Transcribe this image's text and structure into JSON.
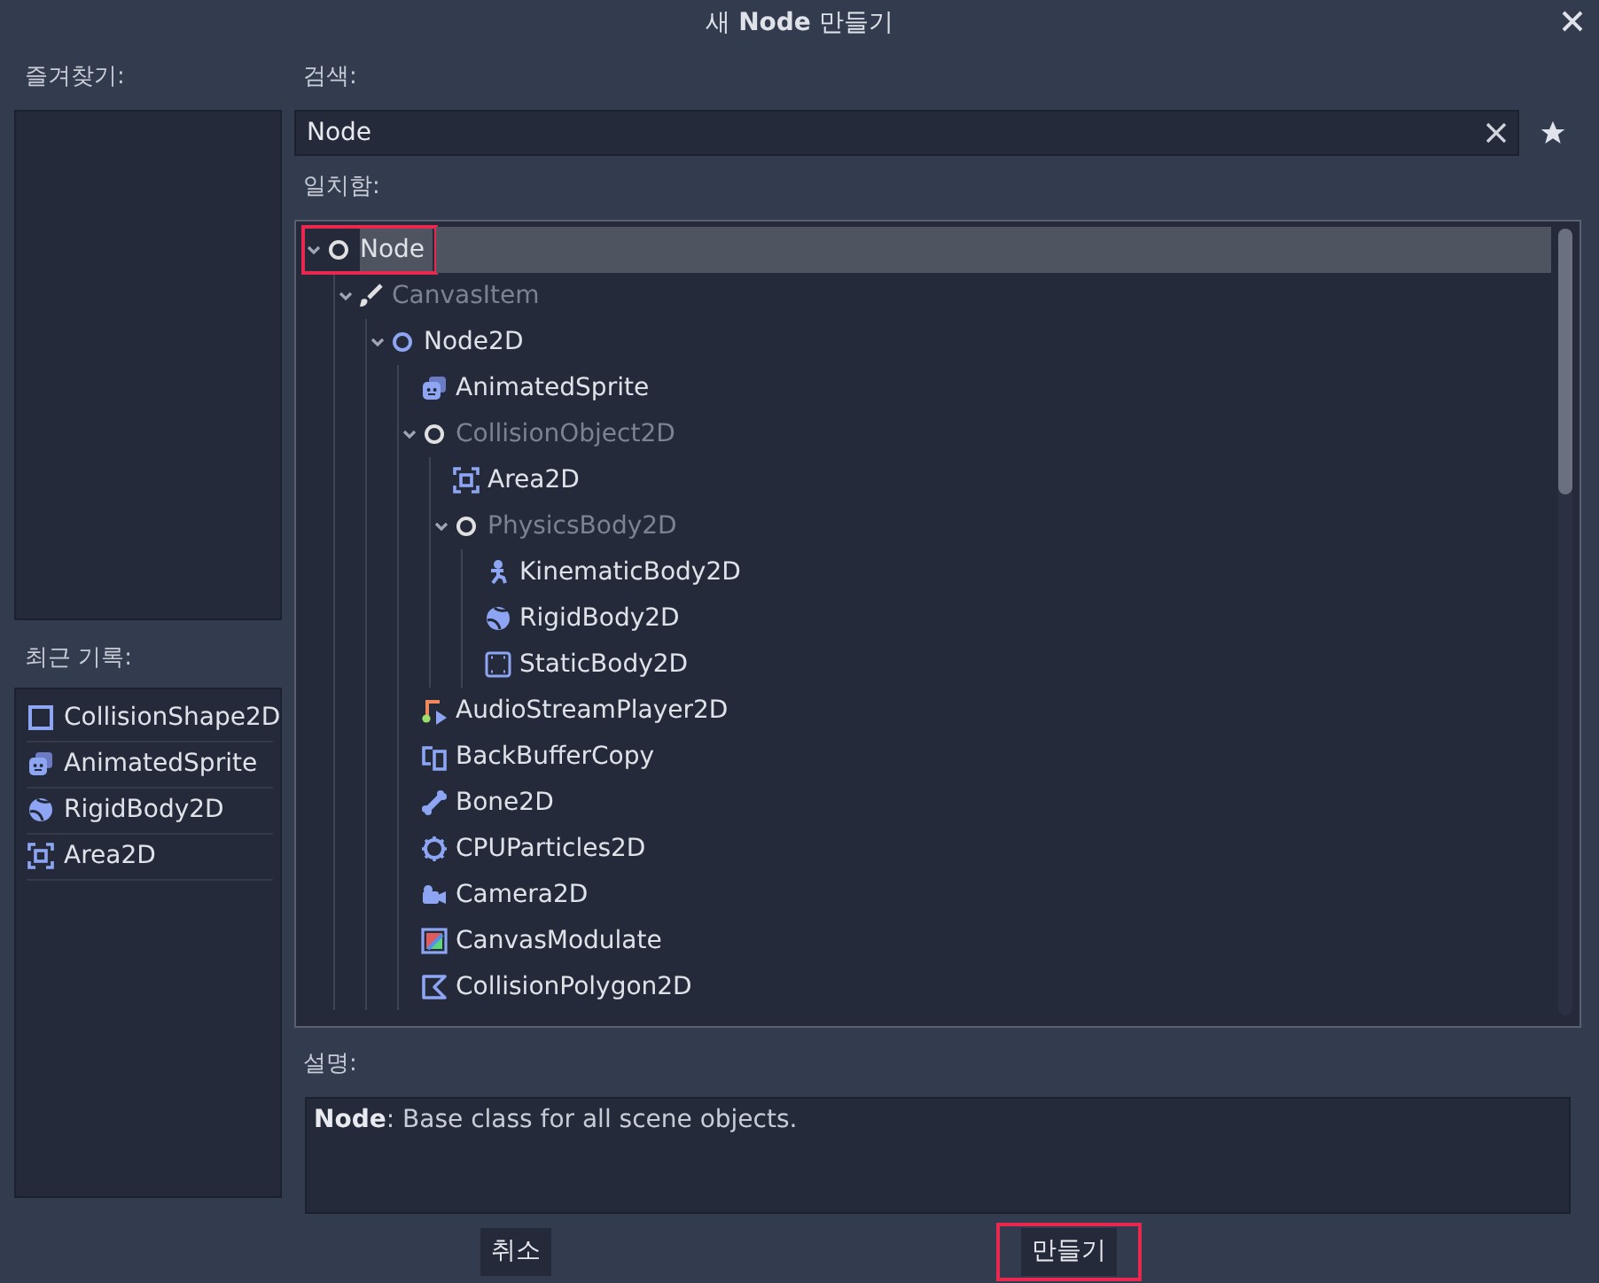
{
  "window": {
    "title": "새 **Node** 만들기"
  },
  "favorites": {
    "label": "즐겨찾기:"
  },
  "recent": {
    "label": "최근 기록:",
    "items": [
      {
        "label": "CollisionShape2D",
        "kind": "shape"
      },
      {
        "label": "AnimatedSprite",
        "kind": "sprite"
      },
      {
        "label": "RigidBody2D",
        "kind": "rigid"
      },
      {
        "label": "Area2D",
        "kind": "area"
      }
    ]
  },
  "search": {
    "label": "검색:",
    "value": "Node"
  },
  "matches": {
    "label": "일치함:",
    "tree": [
      {
        "label": "Node",
        "kind": "node",
        "expanded": true,
        "selected": true,
        "disabled": false,
        "highlighted": true,
        "children": [
          {
            "label": "CanvasItem",
            "kind": "brush",
            "expanded": true,
            "selected": false,
            "disabled": true,
            "highlighted": false,
            "children": [
              {
                "label": "Node2D",
                "kind": "node2d",
                "expanded": true,
                "selected": false,
                "disabled": false,
                "highlighted": false,
                "children": [
                  {
                    "label": "AnimatedSprite",
                    "kind": "sprite",
                    "selected": false,
                    "disabled": false,
                    "highlighted": false
                  },
                  {
                    "label": "CollisionObject2D",
                    "kind": "node",
                    "expanded": true,
                    "selected": false,
                    "disabled": true,
                    "highlighted": false,
                    "children": [
                      {
                        "label": "Area2D",
                        "kind": "area",
                        "selected": false,
                        "disabled": false,
                        "highlighted": false
                      },
                      {
                        "label": "PhysicsBody2D",
                        "kind": "node",
                        "expanded": true,
                        "selected": false,
                        "disabled": true,
                        "highlighted": false,
                        "children": [
                          {
                            "label": "KinematicBody2D",
                            "kind": "kinematic",
                            "selected": false,
                            "disabled": false,
                            "highlighted": false
                          },
                          {
                            "label": "RigidBody2D",
                            "kind": "rigid",
                            "selected": false,
                            "disabled": false,
                            "highlighted": false
                          },
                          {
                            "label": "StaticBody2D",
                            "kind": "static",
                            "selected": false,
                            "disabled": false,
                            "highlighted": false
                          }
                        ]
                      }
                    ]
                  },
                  {
                    "label": "AudioStreamPlayer2D",
                    "kind": "audio",
                    "selected": false,
                    "disabled": false,
                    "highlighted": false
                  },
                  {
                    "label": "BackBufferCopy",
                    "kind": "backbuffer",
                    "selected": false,
                    "disabled": false,
                    "highlighted": false
                  },
                  {
                    "label": "Bone2D",
                    "kind": "bone",
                    "selected": false,
                    "disabled": false,
                    "highlighted": false
                  },
                  {
                    "label": "CPUParticles2D",
                    "kind": "particles",
                    "selected": false,
                    "disabled": false,
                    "highlighted": false
                  },
                  {
                    "label": "Camera2D",
                    "kind": "camera",
                    "selected": false,
                    "disabled": false,
                    "highlighted": false
                  },
                  {
                    "label": "CanvasModulate",
                    "kind": "modulate",
                    "selected": false,
                    "disabled": false,
                    "highlighted": false
                  },
                  {
                    "label": "CollisionPolygon2D",
                    "kind": "polygon",
                    "selected": false,
                    "disabled": false,
                    "highlighted": false
                  }
                ]
              }
            ]
          }
        ]
      }
    ]
  },
  "description": {
    "label": "설명:",
    "text": "**Node**: Base class for all scene objects."
  },
  "buttons": [
    {
      "label": "취소",
      "highlighted": false
    },
    {
      "label": "만들기",
      "highlighted": true
    }
  ]
}
